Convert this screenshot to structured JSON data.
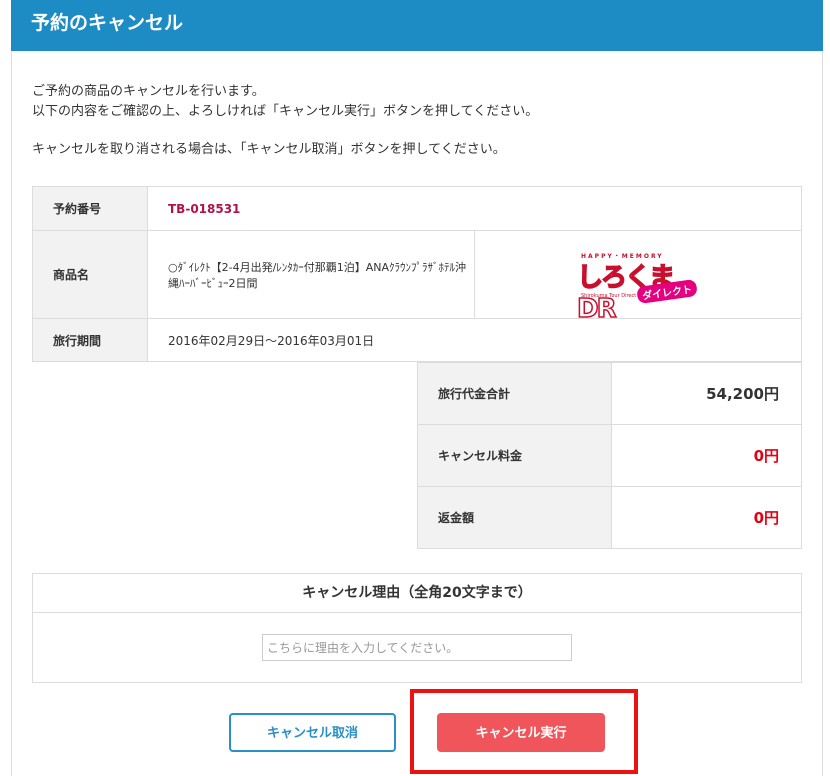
{
  "header": {
    "title": "予約のキャンセル"
  },
  "intro": {
    "line1": "ご予約の商品のキャンセルを行います。",
    "line2": "以下の内容をご確認の上、よろしければ「キャンセル実行」ボタンを押してください。",
    "line3": "キャンセルを取り消される場合は、「キャンセル取消」ボタンを押してください。"
  },
  "reservation": {
    "number_label": "予約番号",
    "number_value": "TB-018531",
    "product_label": "商品名",
    "product_value": "○ﾀﾞｲﾚｸﾄ【2-4月出発/ﾚﾝﾀｶｰ付那覇1泊】ANAｸﾗｳﾝﾌﾟﾗｻﾞﾎﾃﾙ沖縄ﾊｰﾊﾞｰﾋﾞｭｰ2日間",
    "period_label": "旅行期間",
    "period_value": "2016年02月29日～2016年03月01日"
  },
  "logo": {
    "top_text": "HAPPY・MEMORY",
    "main_text": "しろくまDR",
    "sub_text": "Shirokuma Tour Direct",
    "badge_text": "ダイレクト"
  },
  "price": {
    "total_label": "旅行代金合計",
    "total_value": "54,200円",
    "fee_label": "キャンセル料金",
    "fee_value": "0円",
    "refund_label": "返金額",
    "refund_value": "0円"
  },
  "reason": {
    "title": "キャンセル理由（全角20文字まで）",
    "placeholder": "こちらに理由を入力してください。",
    "value": ""
  },
  "buttons": {
    "undo_label": "キャンセル取消",
    "exec_label": "キャンセル実行"
  },
  "colors": {
    "header_bg": "#1e8cc4",
    "accent_red": "#e60012",
    "exec_button": "#f0555b",
    "undo_button_border": "#2a8fc5",
    "highlight_box": "#ee1111"
  }
}
